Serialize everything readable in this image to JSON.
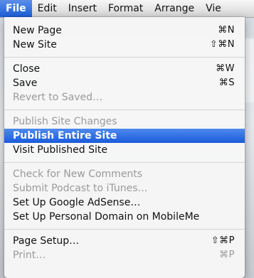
{
  "menubar": {
    "items": [
      {
        "label": "File"
      },
      {
        "label": "Edit"
      },
      {
        "label": "Insert"
      },
      {
        "label": "Format"
      },
      {
        "label": "Arrange"
      },
      {
        "label": "Vie"
      }
    ]
  },
  "file_menu": {
    "new_page": {
      "label": "New Page",
      "shortcut": "⌘N"
    },
    "new_site": {
      "label": "New Site",
      "shortcut": "⇧⌘N"
    },
    "close": {
      "label": "Close",
      "shortcut": "⌘W"
    },
    "save": {
      "label": "Save",
      "shortcut": "⌘S"
    },
    "revert": {
      "label": "Revert to Saved…"
    },
    "publish_changes": {
      "label": "Publish Site Changes"
    },
    "publish_entire": {
      "label": "Publish Entire Site"
    },
    "visit_published": {
      "label": "Visit Published Site"
    },
    "check_comments": {
      "label": "Check for New Comments"
    },
    "submit_podcast": {
      "label": "Submit Podcast to iTunes…"
    },
    "adsense": {
      "label": "Set Up Google AdSense…"
    },
    "personal_domain": {
      "label": "Set Up Personal Domain on MobileMe"
    },
    "page_setup": {
      "label": "Page Setup…",
      "shortcut": "⇧⌘P"
    },
    "print": {
      "label": "Print…",
      "shortcut": "⌘P"
    }
  }
}
